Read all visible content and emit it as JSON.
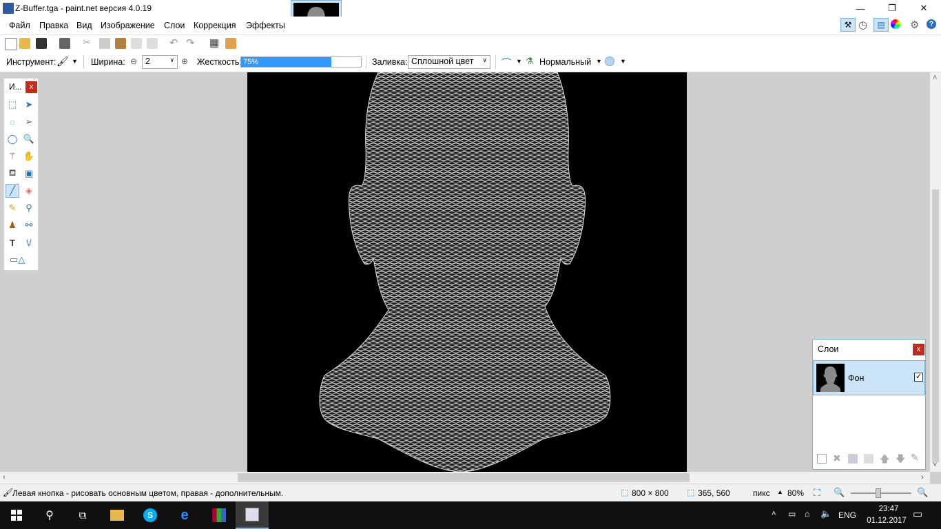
{
  "window": {
    "title": "Z-Buffer.tga - paint.net версия 4.0.19"
  },
  "menu": {
    "items": [
      "Файл",
      "Правка",
      "Вид",
      "Изображение",
      "Слои",
      "Коррекция",
      "Эффекты"
    ]
  },
  "toolbar": {
    "tool_label": "Инструмент:",
    "width_label": "Ширина:",
    "width_value": "2",
    "hardness_label": "Жесткость:",
    "hardness_value": "75%",
    "hardness_fraction": 0.75,
    "fill_label": "Заливка:",
    "fill_value": "Сплошной цвет",
    "blend_value": "Нормальный"
  },
  "tools_panel": {
    "title": "И...",
    "close": "x"
  },
  "layers_panel": {
    "title": "Слои",
    "close": "x",
    "layers": [
      {
        "name": "Фон",
        "visible": true
      }
    ]
  },
  "status": {
    "hint": "Левая кнопка - рисовать основным цветом, правая - дополнительным.",
    "image_size": "800 × 800",
    "cursor_pos": "365, 560",
    "units": "пикс",
    "zoom": "80%"
  },
  "taskbar": {
    "language": "ENG",
    "time": "23:47",
    "date": "01.12.2017"
  },
  "colors": {
    "accent": "#3399ff",
    "close_red": "#c42b1c",
    "selection": "#cce4f7"
  }
}
